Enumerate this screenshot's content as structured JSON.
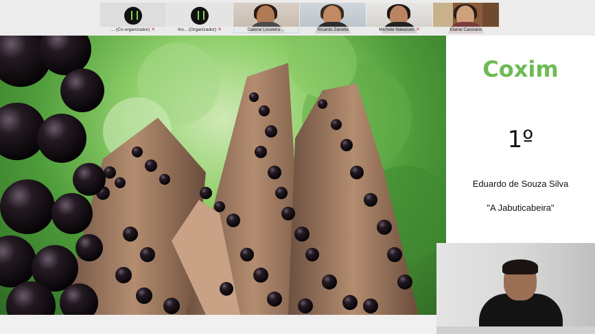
{
  "participants": [
    {
      "name": "(Co-organizador)",
      "prefix": "...",
      "type": "logo"
    },
    {
      "name": "Ins... (Organizador)",
      "prefix": "",
      "type": "logo"
    },
    {
      "name": "Daiene Louveira ...",
      "prefix": "",
      "type": "video",
      "active": true
    },
    {
      "name": "Ricardo Zanella",
      "prefix": "",
      "type": "video"
    },
    {
      "name": "Michele Nakazato",
      "prefix": "",
      "type": "video"
    },
    {
      "name": "Elaine Cassiano",
      "prefix": "",
      "type": "video"
    }
  ],
  "slide": {
    "city": "Coxim",
    "place": "1º",
    "author": "Eduardo de Souza Silva",
    "work": "\"A Jabuticabeira\""
  },
  "icons": {
    "mic_muted": "mic-muted-icon",
    "logo": "organization-logo-icon"
  },
  "colors": {
    "accent_green": "#6dbb53",
    "active_border": "#3fa3e8",
    "muted_mic": "#d32f2f"
  }
}
